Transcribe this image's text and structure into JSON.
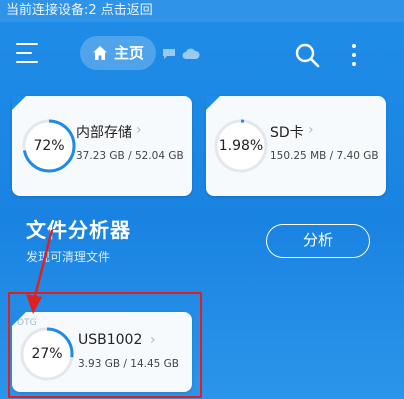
{
  "status_bar": {
    "text": "当前连接设备:2 点击返回"
  },
  "toolbar": {
    "home_label": "主页",
    "icons": [
      "menu-icon",
      "home-icon",
      "message-icon",
      "cloud-icon",
      "search-icon",
      "more-vert-icon"
    ]
  },
  "storage": {
    "internal": {
      "percent_label": "72%",
      "percent": 72,
      "title": "内部存储",
      "size": "37.23 GB / 52.04 GB"
    },
    "sdcard": {
      "percent_label": "1.98%",
      "percent": 1.98,
      "title": "SD卡",
      "size": "150.25 MB / 7.40 GB"
    },
    "usb": {
      "percent_label": "27%",
      "percent": 27,
      "title": "USB1002",
      "size": "3.93 GB / 14.45 GB",
      "badge": "OTG"
    }
  },
  "analyzer": {
    "title": "文件分析器",
    "subtitle": "发现可清理文件",
    "button_label": "分析"
  },
  "colors": {
    "background": "#1f8de8",
    "ring_track": "#e3e8ee",
    "ring_fill": "#1f8be7",
    "highlight": "#e02020"
  }
}
